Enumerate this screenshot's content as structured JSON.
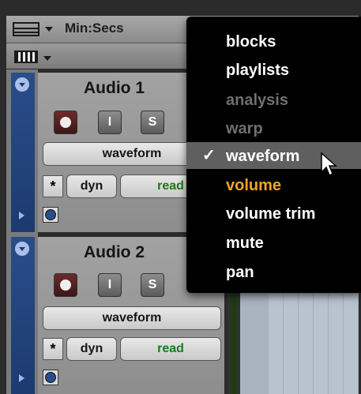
{
  "ruler": {
    "time_format": "Min:Secs"
  },
  "tracks": [
    {
      "name": "Audio 1",
      "solo_label": "S",
      "input_label": "I",
      "view_label": "waveform",
      "dyn_label": "dyn",
      "automation_label": "read",
      "star_label": "*"
    },
    {
      "name": "Audio 2",
      "solo_label": "S",
      "input_label": "I",
      "view_label": "waveform",
      "dyn_label": "dyn",
      "automation_label": "read",
      "star_label": "*"
    }
  ],
  "menu": {
    "items": [
      {
        "label": "blocks",
        "state": "enabled"
      },
      {
        "label": "playlists",
        "state": "enabled"
      },
      {
        "label": "analysis",
        "state": "disabled"
      },
      {
        "label": "warp",
        "state": "disabled"
      },
      {
        "label": "waveform",
        "state": "checked"
      },
      {
        "label": "volume",
        "state": "highlighted"
      },
      {
        "label": "volume trim",
        "state": "enabled"
      },
      {
        "label": "mute",
        "state": "enabled"
      },
      {
        "label": "pan",
        "state": "enabled"
      }
    ],
    "checkmark": "✓",
    "highlight_color": "#f0a52a"
  },
  "colors": {
    "automation_read": "#1b7a1b",
    "track_blue": "#2a4d8a"
  }
}
